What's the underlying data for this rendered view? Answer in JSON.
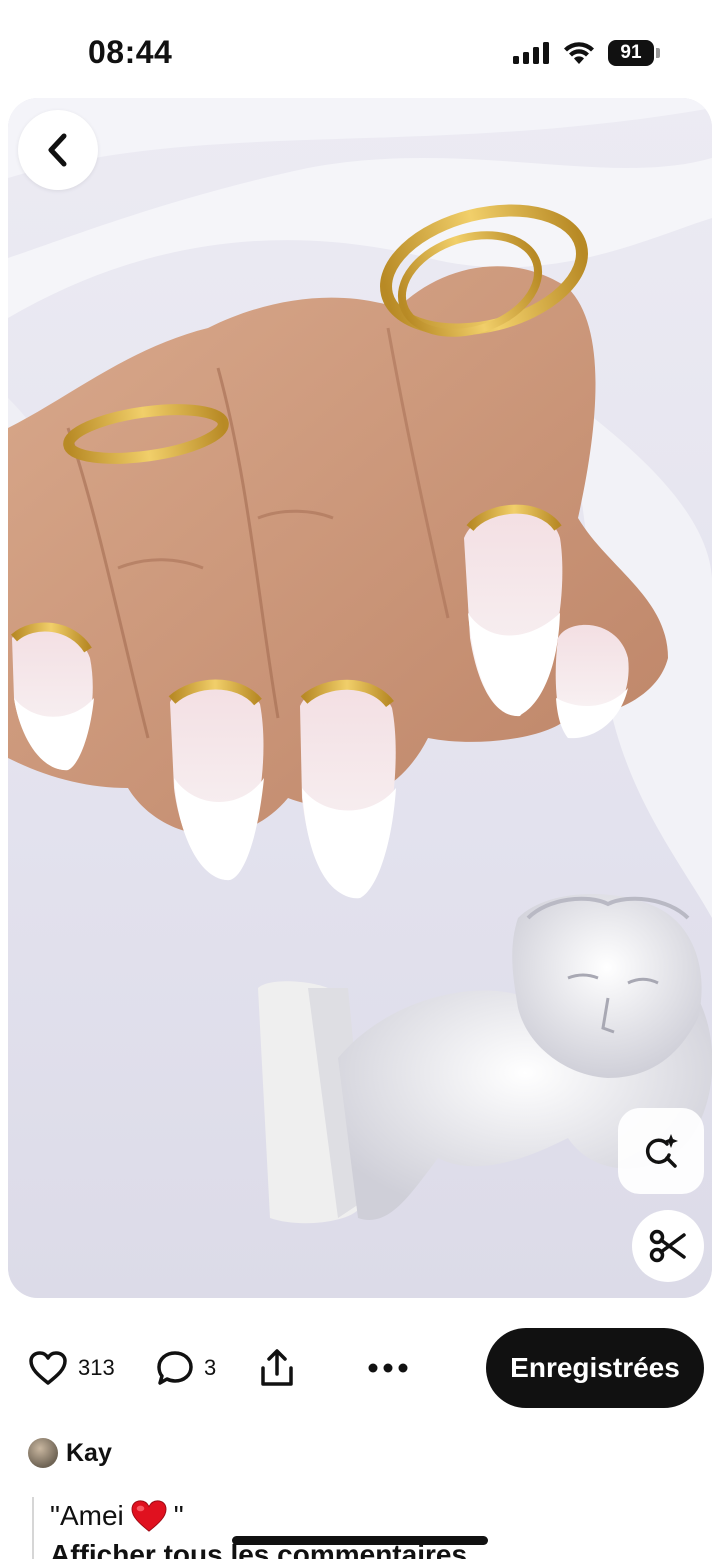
{
  "status_bar": {
    "time": "08:44",
    "battery": "91"
  },
  "pin": {
    "image_icon": "nails-photo",
    "actions": {
      "back_icon": "chevron-left-icon",
      "visual_search_icon": "visual-search-icon",
      "cut_icon": "scissors-icon"
    }
  },
  "action_bar": {
    "like_count": "313",
    "comment_count": "3",
    "share_icon": "share-icon",
    "more_icon": "more-dots-icon",
    "save_label": "Enregistrées"
  },
  "comments": {
    "author": "Kay",
    "text_before": "\"Amei",
    "text_after": "\"",
    "emoji": "red-heart",
    "view_all_label": "Afficher tous les commentaires"
  },
  "colors": {
    "save_button_bg": "#111111",
    "heart_red": "#e0111f",
    "gold": "#d4a83a"
  }
}
